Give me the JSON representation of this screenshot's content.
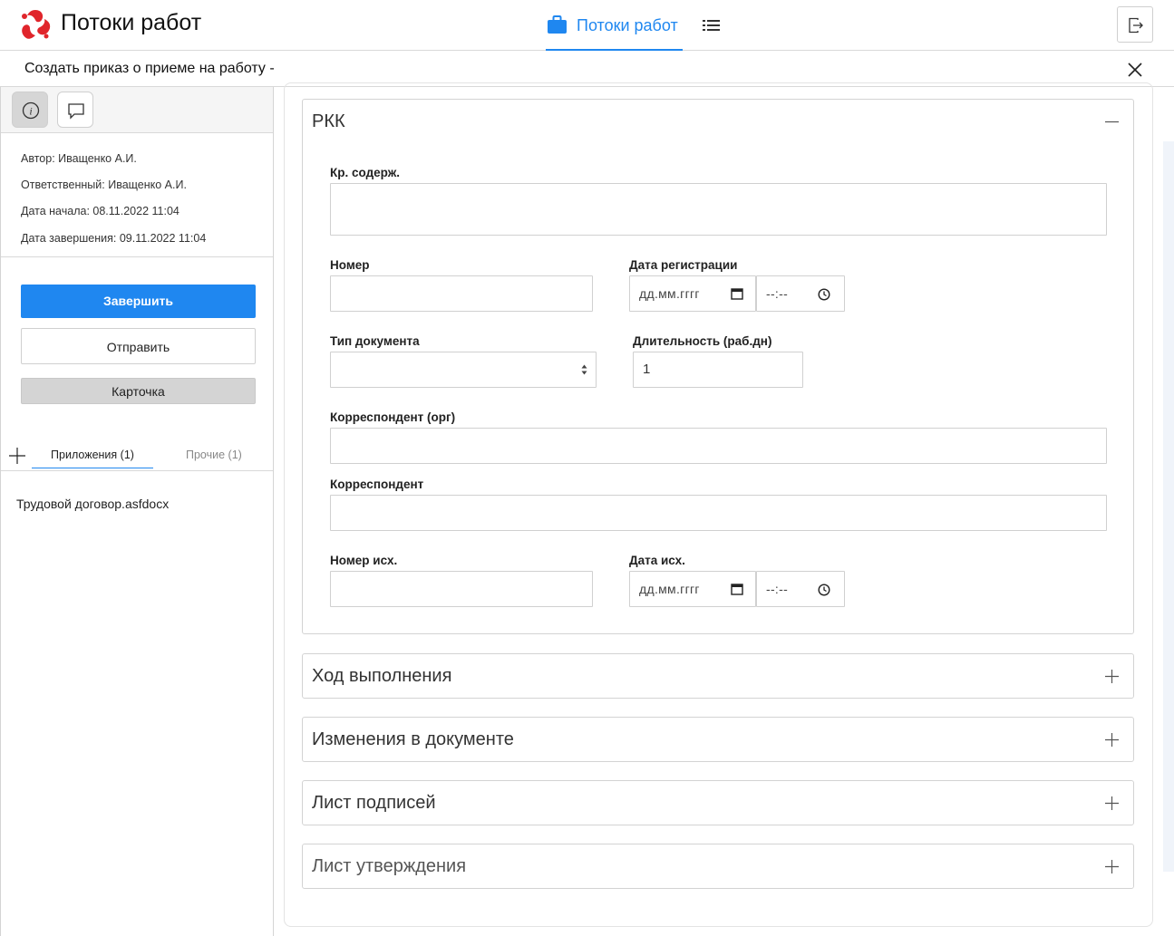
{
  "header": {
    "app_title": "Потоки работ",
    "nav_tab_label": "Потоки работ",
    "brand_color": "#e0252b",
    "accent_color": "#1f87f0",
    "icons": [
      "logo-icon",
      "briefcase-icon",
      "list-icon",
      "logout-icon"
    ]
  },
  "subheader": {
    "title": "Создать приказ о приеме на работу -",
    "close_icon": "close-icon"
  },
  "sidebar": {
    "tool_icons": [
      "info-icon",
      "comment-icon"
    ],
    "meta": {
      "author": "Автор: Иващенко А.И.",
      "responsible": "Ответственный: Иващенко А.И.",
      "start_date": "Дата начала: 08.11.2022 11:04",
      "end_date": "Дата завершения: 09.11.2022 11:04"
    },
    "buttons": {
      "finish": "Завершить",
      "send": "Отправить",
      "card": "Карточка"
    },
    "attachment_tabs": {
      "attachments": "Приложения (1)",
      "other": "Прочие (1)"
    },
    "files": [
      "Трудовой договор.asfdocx"
    ]
  },
  "rkk": {
    "title": "РКК",
    "fields": {
      "summary_label": "Кр. содерж.",
      "number_label": "Номер",
      "reg_date_label": "Дата регистрации",
      "doc_type_label": "Тип документа",
      "duration_label": "Длительность (раб.дн)",
      "duration_value": "1",
      "correspondent_org_label": "Корреспондент (орг)",
      "correspondent_label": "Корреспондент",
      "out_number_label": "Номер исх.",
      "out_date_label": "Дата исх.",
      "date_placeholder": "дд.мм.гггг",
      "time_placeholder": "--:--"
    }
  },
  "sections": [
    {
      "title": "Ход выполнения"
    },
    {
      "title": "Изменения в документе"
    },
    {
      "title": "Лист подписей"
    },
    {
      "title": "Лист утверждения"
    }
  ]
}
